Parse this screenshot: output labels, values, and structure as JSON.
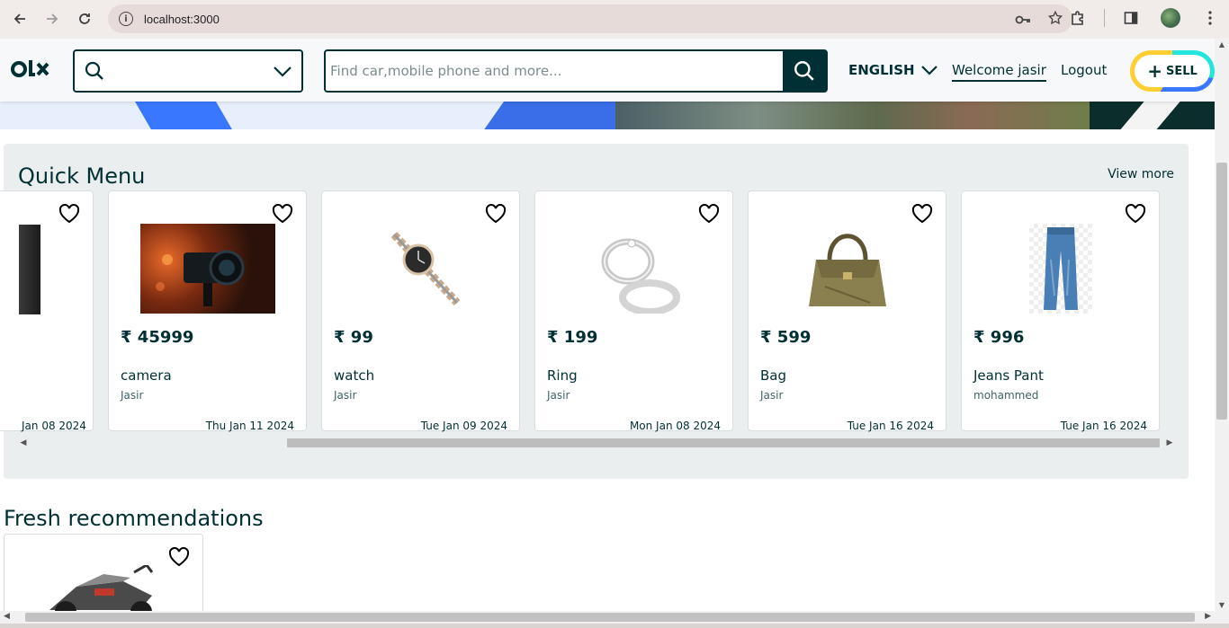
{
  "browser": {
    "url": "localhost:3000",
    "icons": [
      "back-icon",
      "forward-icon",
      "reload-icon",
      "info-icon",
      "key-icon",
      "star-icon",
      "extensions-icon",
      "sidepanel-icon",
      "profile-avatar",
      "menu-icon"
    ]
  },
  "header": {
    "logo": "olx",
    "search_placeholder": "Find car,mobile phone and more...",
    "language": "ENGLISH",
    "welcome": "Welcome jasir",
    "logout": "Logout",
    "sell": "SELL"
  },
  "quick_menu": {
    "title": "Quick Menu",
    "view_more": "View more",
    "partial_card_date": "Jan 08 2024",
    "items": [
      {
        "price": "₹ 45999",
        "name": "camera",
        "seller": "Jasir",
        "date": "Thu Jan 11 2024",
        "image": "camera"
      },
      {
        "price": "₹ 99",
        "name": "watch",
        "seller": "Jasir",
        "date": "Tue Jan 09 2024",
        "image": "watch"
      },
      {
        "price": "₹ 199",
        "name": "Ring",
        "seller": "Jasir",
        "date": "Mon Jan 08 2024",
        "image": "ring"
      },
      {
        "price": "₹ 599",
        "name": "Bag",
        "seller": "Jasir",
        "date": "Tue Jan 16 2024",
        "image": "bag"
      },
      {
        "price": "₹ 996",
        "name": "Jeans Pant",
        "seller": "mohammed",
        "date": "Tue Jan 16 2024",
        "image": "jeans"
      }
    ]
  },
  "fresh": {
    "title": "Fresh recommendations"
  },
  "colors": {
    "brand": "#002f34",
    "panel": "#ebeeef",
    "sell_ring": [
      "#23e5db",
      "#3a77ff",
      "#ffce32"
    ]
  }
}
